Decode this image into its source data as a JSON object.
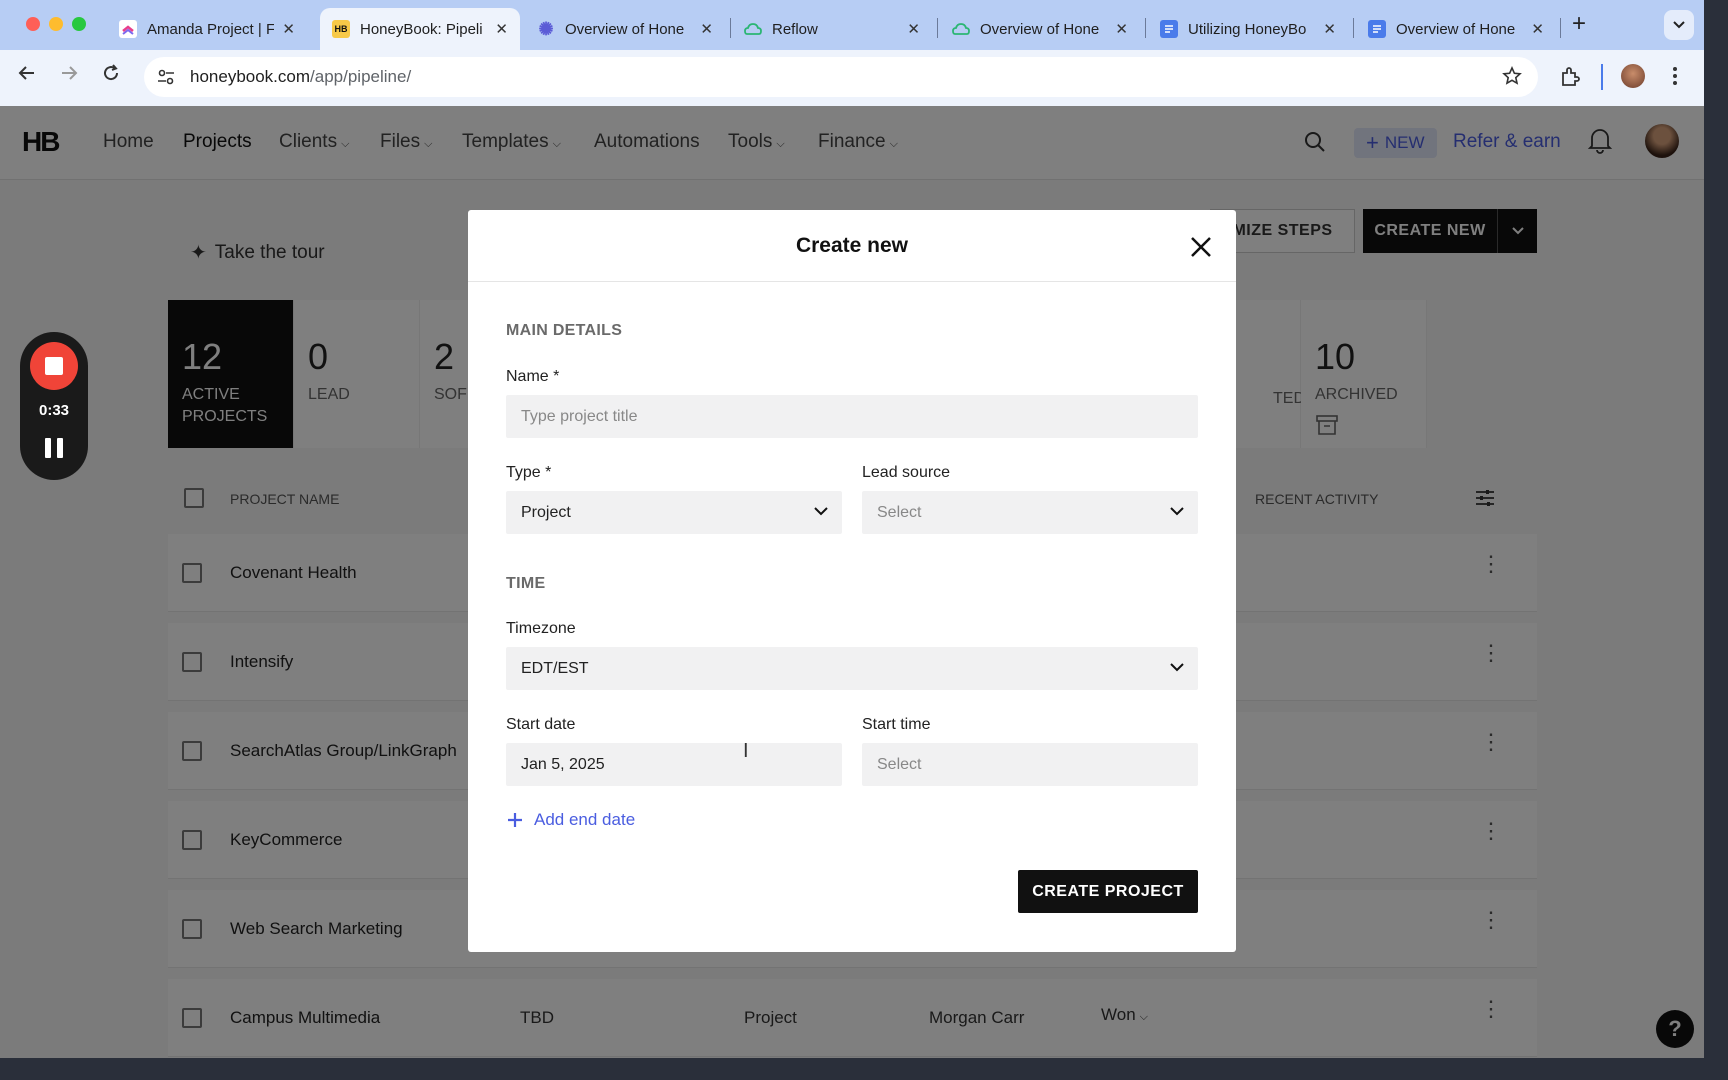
{
  "browser": {
    "tabs": [
      {
        "title": "Amanda Project | F",
        "favicon": "clickup-icon",
        "color": "#ffffff"
      },
      {
        "title": "HoneyBook: Pipeli",
        "favicon": "honeybook-icon",
        "color": "#f7c948"
      },
      {
        "title": "Overview of Hone",
        "favicon": "gear-flower-icon",
        "color": "#5b5bd6"
      },
      {
        "title": "Reflow",
        "favicon": "cloud-icon",
        "color": "#2bb673"
      },
      {
        "title": "Overview of Hone",
        "favicon": "cloud-icon",
        "color": "#2bb673"
      },
      {
        "title": "Utilizing HoneyBo",
        "favicon": "docs-icon",
        "color": "#4a7bea"
      },
      {
        "title": "Overview of Hone",
        "favicon": "docs-icon",
        "color": "#4a7bea"
      }
    ],
    "url_host": "honeybook.com",
    "url_path": "/app/pipeline/"
  },
  "nav": {
    "logo": "HB",
    "items": [
      {
        "label": "Home",
        "caret": false
      },
      {
        "label": "Projects",
        "caret": false
      },
      {
        "label": "Clients",
        "caret": true
      },
      {
        "label": "Files",
        "caret": true
      },
      {
        "label": "Templates",
        "caret": true
      },
      {
        "label": "Automations",
        "caret": false
      },
      {
        "label": "Tools",
        "caret": true
      },
      {
        "label": "Finance",
        "caret": true
      }
    ],
    "new_label": "NEW",
    "refer_label": "Refer & earn"
  },
  "page": {
    "tour_label": "Take the tour",
    "customize_label": "MIZE STEPS",
    "create_new_label": "CREATE NEW",
    "stages_left": [
      {
        "count": "12",
        "label": "ACTIVE PROJECTS"
      },
      {
        "count": "0",
        "label": "LEAD"
      },
      {
        "count": "2",
        "label": "SOF"
      }
    ],
    "stages_right": [
      {
        "count": "",
        "label": "TED"
      },
      {
        "count": "10",
        "label": "ARCHIVED"
      }
    ],
    "columns": {
      "name": "PROJECT NAME",
      "activity": "RECENT ACTIVITY"
    },
    "rows": [
      {
        "name": "Covenant Health"
      },
      {
        "name": "Intensify"
      },
      {
        "name": "SearchAtlas Group/LinkGraph"
      },
      {
        "name": "KeyCommerce"
      },
      {
        "name": "Web Search Marketing"
      },
      {
        "name": "Campus Multimedia",
        "date": "TBD",
        "type": "Project",
        "owner": "Morgan Carr",
        "status": "Won"
      }
    ]
  },
  "recorder": {
    "time": "0:33"
  },
  "modal": {
    "title": "Create new",
    "main_details": "MAIN DETAILS",
    "name_label": "Name *",
    "name_placeholder": "Type project title",
    "type_label": "Type *",
    "type_value": "Project",
    "lead_source_label": "Lead source",
    "lead_source_value": "Select",
    "time_section": "TIME",
    "timezone_label": "Timezone",
    "timezone_value": "EDT/EST",
    "start_date_label": "Start date",
    "start_date_value": "Jan 5, 2025",
    "start_time_label": "Start time",
    "start_time_value": "Select",
    "add_end_label": "Add end date",
    "submit_label": "CREATE PROJECT"
  },
  "help_label": "?"
}
